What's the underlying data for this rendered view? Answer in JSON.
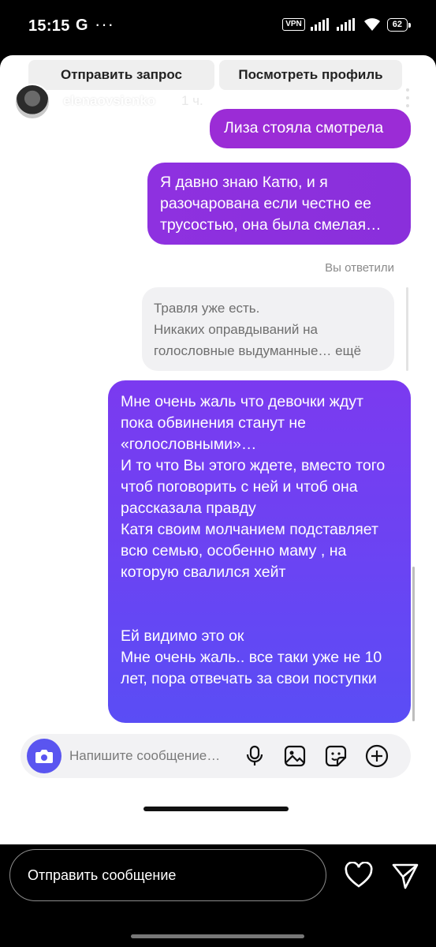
{
  "status_bar": {
    "time": "15:15",
    "g_icon": "G",
    "dots": "···",
    "vpn": "VPN",
    "battery": "62"
  },
  "story": {
    "request_button": "Отправить запрос",
    "profile_button": "Посмотреть профиль",
    "username": "elenaovsienko",
    "time_ago": "1 ч."
  },
  "messages": {
    "m1": "Лиза стояла смотрела",
    "m2": "Я давно знаю Катю, и я разочарована если честно ее трусостью, она была смелая…",
    "replied_label": "Вы ответили",
    "quote_line1": "Травля уже есть.",
    "quote_line2": "Никаких оправдываний на голословные выдуманные… ещё",
    "m3_p1": "Мне очень жаль что девочки ждут пока обвинения станут не «голословными»…",
    "m3_p2": "И то что Вы этого ждете, вместо того чтоб поговорить с ней и чтоб она рассказала правду",
    "m3_p3": "Катя своим молчанием подставляет всю семью, особенно маму , на которую свалился хейт",
    "m3_p4": "Ей видимо это ок",
    "m3_p5": "Мне очень жаль.. все таки уже не 10 лет, пора отвечать за свои поступки"
  },
  "composer": {
    "placeholder": "Напишите сообщение…"
  },
  "bottom": {
    "send_message": "Отправить сообщение"
  },
  "colors": {
    "bubble_magenta": "#9b2cd6",
    "bubble_purple": "#8e31e0",
    "bubble_indigo": "#6a44f3",
    "camera_button": "#5a55f0"
  },
  "icons": [
    "g-icon",
    "vpn-icon",
    "signal-icon",
    "wifi-icon",
    "battery-icon",
    "more-vert-icon",
    "camera-icon",
    "mic-icon",
    "gallery-icon",
    "sticker-icon",
    "plus-icon",
    "heart-icon",
    "send-icon"
  ]
}
